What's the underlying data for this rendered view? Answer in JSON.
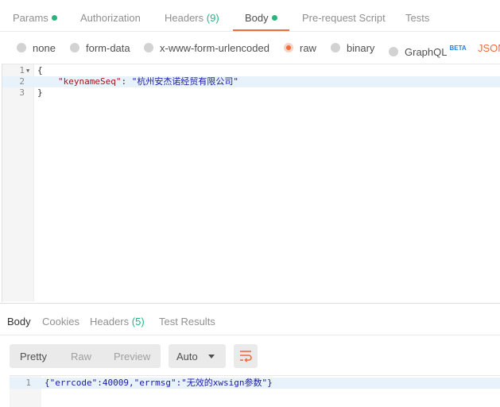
{
  "request_tabs": [
    {
      "label": "Params",
      "dot": true
    },
    {
      "label": "Authorization"
    },
    {
      "label": "Headers",
      "count": "(9)"
    },
    {
      "label": "Body",
      "dot": true,
      "active": true
    },
    {
      "label": "Pre-request Script"
    },
    {
      "label": "Tests"
    }
  ],
  "body_types": {
    "none": "none",
    "form_data": "form-data",
    "urlencoded": "x-www-form-urlencoded",
    "raw": "raw",
    "binary": "binary",
    "graphql": "GraphQL",
    "graphql_badge": "BETA",
    "selected": "raw",
    "format": "JSON"
  },
  "request_body": {
    "lines": [
      {
        "num": "1",
        "open": "{"
      },
      {
        "num": "2",
        "key": "\"keynameSeq\"",
        "sep": ": ",
        "value": "\"杭州安杰诺经贸有限公司\""
      },
      {
        "num": "3",
        "close": "}"
      }
    ]
  },
  "response_tabs": [
    {
      "label": "Body",
      "active": true
    },
    {
      "label": "Cookies"
    },
    {
      "label": "Headers",
      "count": "(5)"
    },
    {
      "label": "Test Results"
    }
  ],
  "response_view": {
    "pretty": "Pretty",
    "raw": "Raw",
    "preview": "Preview",
    "format": "Auto"
  },
  "response_body": {
    "line_num": "1",
    "text": "{\"errcode\":40009,\"errmsg\":\"无效的xwsign参数\"}"
  },
  "colors": {
    "accent": "#f26b3a",
    "count_green": "#26b47f",
    "beta_blue": "#2f7fd4"
  },
  "icons": [
    "fold-arrow-icon",
    "word-wrap-icon",
    "caret-down-icon"
  ]
}
